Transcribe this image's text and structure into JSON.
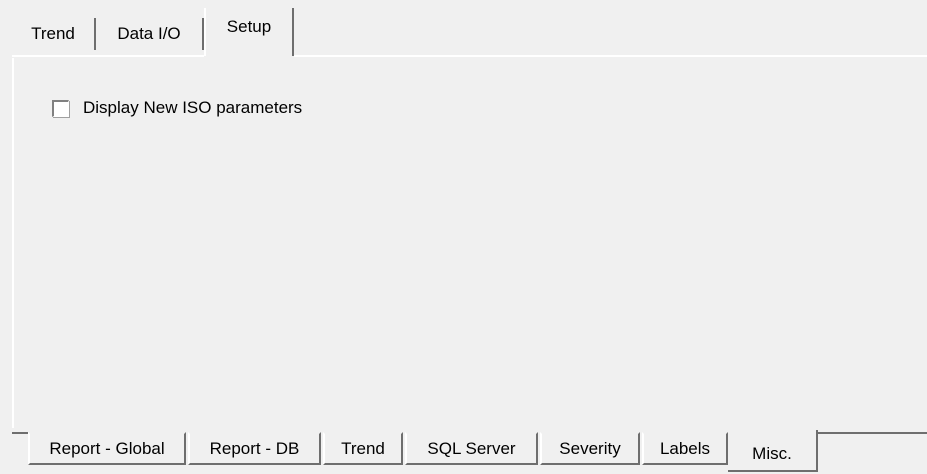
{
  "top_tabs": [
    {
      "label": "Trend",
      "active": false
    },
    {
      "label": "Data I/O",
      "active": false
    },
    {
      "label": "Setup",
      "active": true
    }
  ],
  "setup_panel": {
    "checkbox_label": "Display New ISO parameters",
    "checkbox_checked": false
  },
  "bottom_tabs": [
    {
      "label": "Report - Global",
      "active": false
    },
    {
      "label": "Report - DB",
      "active": false
    },
    {
      "label": "Trend",
      "active": false
    },
    {
      "label": "SQL Server",
      "active": false
    },
    {
      "label": "Severity",
      "active": false
    },
    {
      "label": "Labels",
      "active": false
    },
    {
      "label": "Misc.",
      "active": true
    }
  ]
}
